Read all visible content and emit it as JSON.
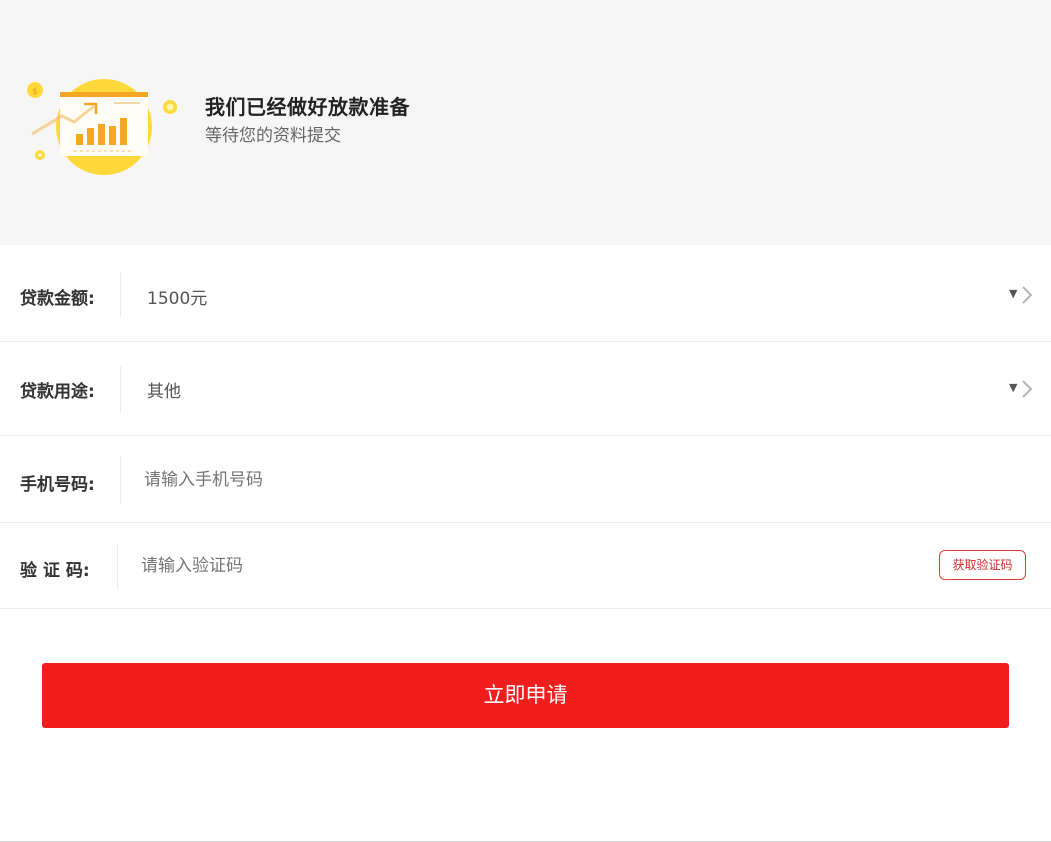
{
  "header": {
    "title": "我们已经做好放款准备",
    "subtitle": "等待您的资料提交"
  },
  "form": {
    "amount": {
      "label": "贷款金额:",
      "value": "1500元"
    },
    "purpose": {
      "label": "贷款用途:",
      "value": "其他"
    },
    "phone": {
      "label": "手机号码:",
      "placeholder": "请输入手机号码"
    },
    "code": {
      "label": "验 证 码:",
      "placeholder": "请输入验证码",
      "button_label": "获取验证码"
    }
  },
  "submit_label": "立即申请",
  "colors": {
    "accent": "#f21d1d",
    "header_bg": "#f6f6f6",
    "illustration_circle": "#ffd83a",
    "illustration_bars": "#f5a623"
  }
}
